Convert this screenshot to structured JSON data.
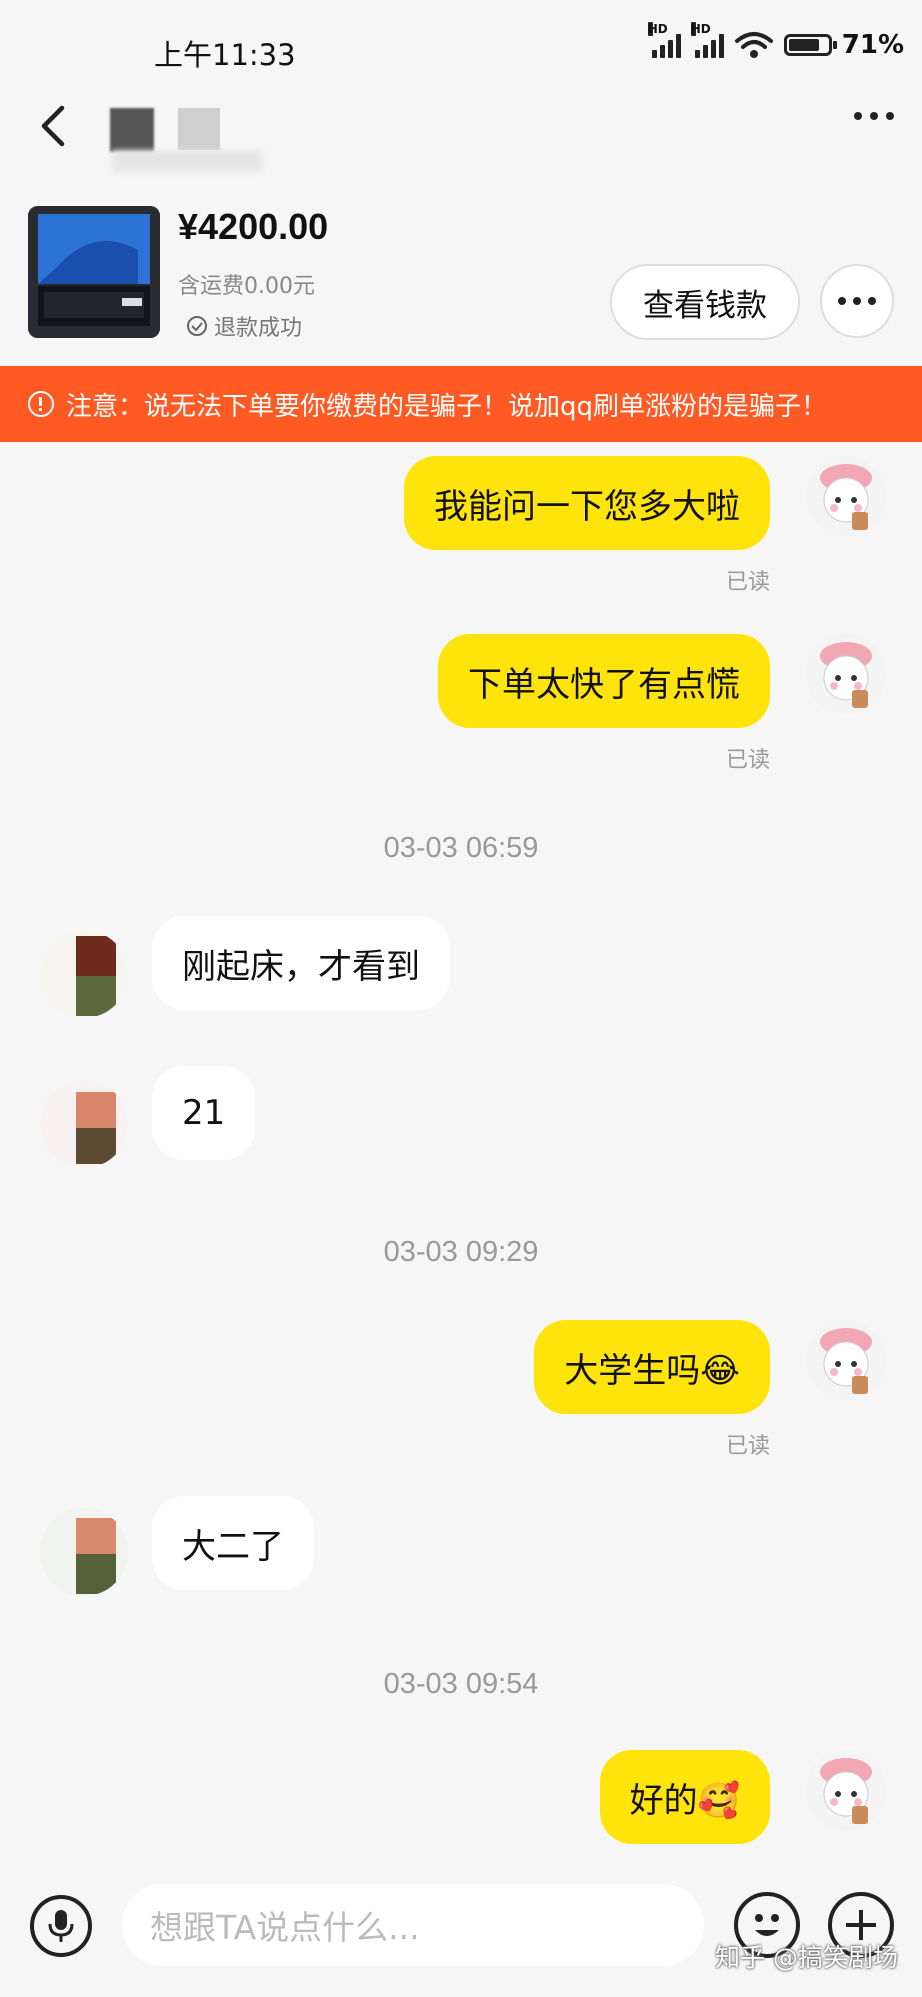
{
  "status_bar": {
    "time": "上午11:33",
    "hd1": "HD",
    "hd2": "HD",
    "battery": "71%",
    "battery_level": 0.71
  },
  "header": {
    "back_icon": "chevron-left-icon",
    "more_icon": "more-horizontal-icon"
  },
  "product": {
    "price": "¥4200.00",
    "shipping": "含运费0.00元",
    "status": "退款成功",
    "view_button": "查看钱款",
    "more_icon": "more-horizontal-icon"
  },
  "warning": {
    "text": "注意：说无法下单要你缴费的是骗子！说加qq刷单涨粉的是骗子！"
  },
  "messages": {
    "m1": "我能问一下您多大啦",
    "m2": "下单太快了有点慌",
    "ts1": "03-03 06:59",
    "m3": "刚起床，才看到",
    "m4": "21",
    "ts2": "03-03 09:29",
    "m5": "大学生吗😂",
    "m6": "大二了",
    "ts3": "03-03 09:54",
    "m7": "好的🥰",
    "read": "已读"
  },
  "input_bar": {
    "placeholder": "想跟TA说点什么...",
    "watermark": "知乎 @搞笑剧场"
  },
  "colors": {
    "accent_yellow": "#ffe40c",
    "warning_orange": "#ff5a23"
  }
}
